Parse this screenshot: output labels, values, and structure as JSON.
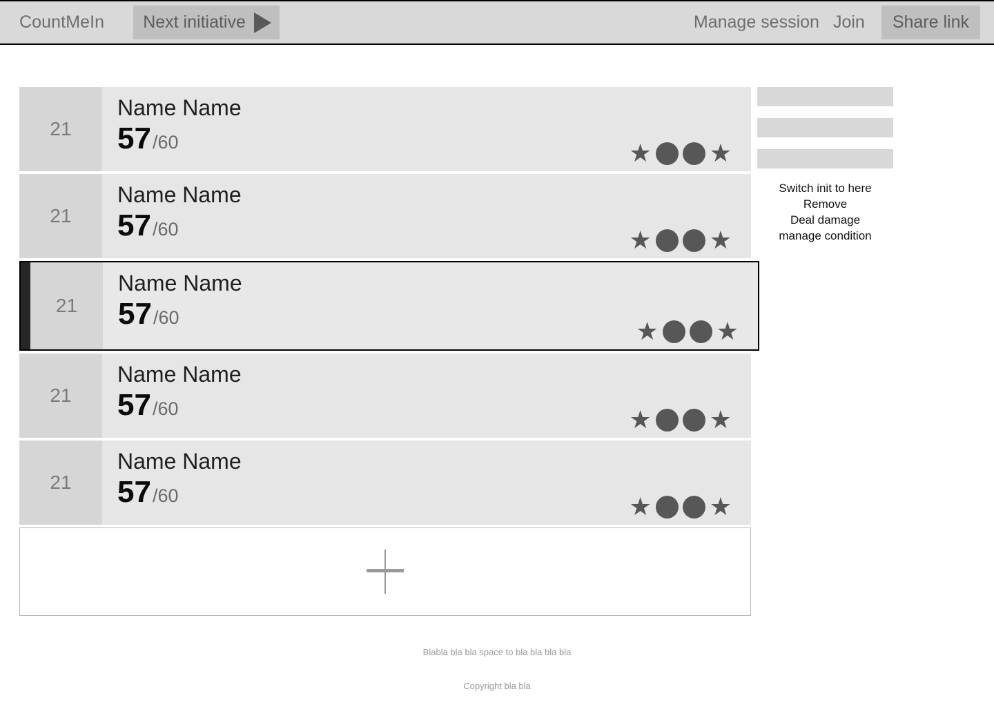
{
  "header": {
    "brand": "CountMeIn",
    "next_initiative_label": "Next initiative",
    "next_initiative_icon": "play-triangle-icon",
    "manage_session_label": "Manage session",
    "join_label": "Join",
    "share_link_label": "Share link"
  },
  "combatants": [
    {
      "initiative": "21",
      "name": "Name Name",
      "hp_current": "57",
      "hp_max": "/60",
      "icons": [
        "star-icon",
        "circle-icon",
        "circle-icon",
        "star-icon"
      ],
      "selected": false
    },
    {
      "initiative": "21",
      "name": "Name Name",
      "hp_current": "57",
      "hp_max": "/60",
      "icons": [
        "star-icon",
        "circle-icon",
        "circle-icon",
        "star-icon"
      ],
      "selected": false
    },
    {
      "initiative": "21",
      "name": "Name Name",
      "hp_current": "57",
      "hp_max": "/60",
      "icons": [
        "star-icon",
        "circle-icon",
        "circle-icon",
        "star-icon"
      ],
      "selected": true
    },
    {
      "initiative": "21",
      "name": "Name Name",
      "hp_current": "57",
      "hp_max": "/60",
      "icons": [
        "star-icon",
        "circle-icon",
        "circle-icon",
        "star-icon"
      ],
      "selected": false
    },
    {
      "initiative": "21",
      "name": "Name Name",
      "hp_current": "57",
      "hp_max": "/60",
      "icons": [
        "star-icon",
        "circle-icon",
        "circle-icon",
        "star-icon"
      ],
      "selected": false
    }
  ],
  "add_row": {
    "icon": "plus-icon"
  },
  "side_panel": {
    "placeholders": [
      "",
      "",
      ""
    ],
    "actions": [
      "Switch init to here",
      "Remove",
      "Deal damage",
      "manage condition"
    ]
  },
  "footer": {
    "note": "Blabla bla bla space to bla bla bla bla",
    "copyright": "Copyright bla bla"
  },
  "colors": {
    "header_bg": "#d9d9d9",
    "button_bg": "#bfbfbf",
    "row_init_bg": "#d6d6d6",
    "row_body_bg": "#e6e6e6",
    "active_bar": "#262626",
    "icon_fill": "#575757",
    "muted_text": "#6e6e6e",
    "placeholder_bg": "#d8d8d8",
    "footer_text": "#999999"
  }
}
